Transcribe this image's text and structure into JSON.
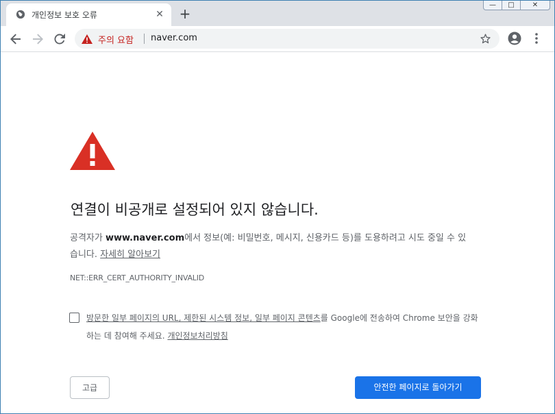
{
  "tab": {
    "title": "개인정보 보호 오류",
    "favicon": "globe-icon",
    "close_glyph": "✕",
    "new_tab_glyph": "+"
  },
  "window_controls": {
    "minimize_glyph": "—",
    "maximize_glyph": "□",
    "close_glyph": "✕"
  },
  "toolbar": {
    "back_icon": "arrow-left-icon",
    "forward_icon": "arrow-right-icon",
    "reload_icon": "reload-icon",
    "security_label": "주의 요함",
    "url": "naver.com",
    "bookmark_icon": "star-icon",
    "profile_icon": "account-circle-icon",
    "menu_icon": "more-vert-icon"
  },
  "page": {
    "heading": "연결이 비공개로 설정되어 있지 않습니다.",
    "desc_prefix": "공격자가 ",
    "desc_domain": "www.naver.com",
    "desc_suffix": "에서 정보(예: 비밀번호, 메시지, 신용카드 등)를 도용하려고 시도 중일 수 있습니다. ",
    "learn_more": "자세히 알아보기",
    "error_code": "NET::ERR_CERT_AUTHORITY_INVALID",
    "optin_link": "방문한 일부 페이지의 URL, 제한된 시스템 정보, 일부 페이지 콘텐츠",
    "optin_text": "를 Google에 전송하여 Chrome 보안을 강화하는 데 참여해 주세요. ",
    "privacy_link": "개인정보처리방침",
    "advanced_button": "고급",
    "back_button": "안전한 페이지로 돌아가기"
  },
  "colors": {
    "danger": "#d93025",
    "primary_button": "#1a73e8",
    "warning_text": "#c5221f"
  }
}
